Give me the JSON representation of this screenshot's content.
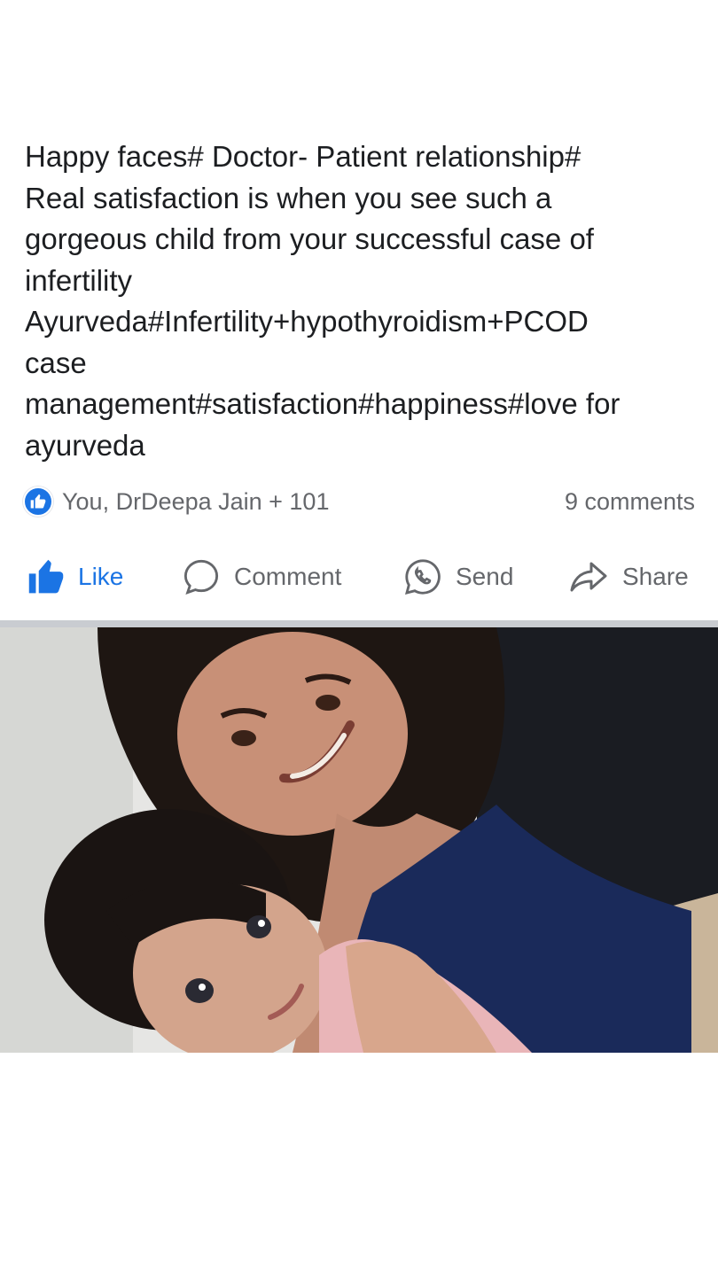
{
  "post": {
    "text_lines": [
      "Happy faces# Doctor- Patient relationship#",
      "Real satisfaction is when you see such a",
      "gorgeous child from your successful case of",
      "infertility",
      "Ayurveda#Infertility+hypothyroidism+PCOD",
      "case",
      "management#satisfaction#happiness#love for",
      "ayurveda"
    ]
  },
  "reactions": {
    "icon": "like-reaction-icon",
    "summary": "You, DrDeepa Jain + 101",
    "comments": "9 comments"
  },
  "actions": {
    "like": {
      "label": "Like",
      "icon": "thumbs-up-icon",
      "color": "#1b74e4"
    },
    "comment": {
      "label": "Comment",
      "icon": "comment-bubble-icon"
    },
    "send": {
      "label": "Send",
      "icon": "whatsapp-icon"
    },
    "share": {
      "label": "Share",
      "icon": "share-arrow-icon"
    }
  },
  "colors": {
    "text": "#1c1e21",
    "muted": "#65676b",
    "accent": "#1b74e4",
    "divider": "#c9ccd1"
  }
}
